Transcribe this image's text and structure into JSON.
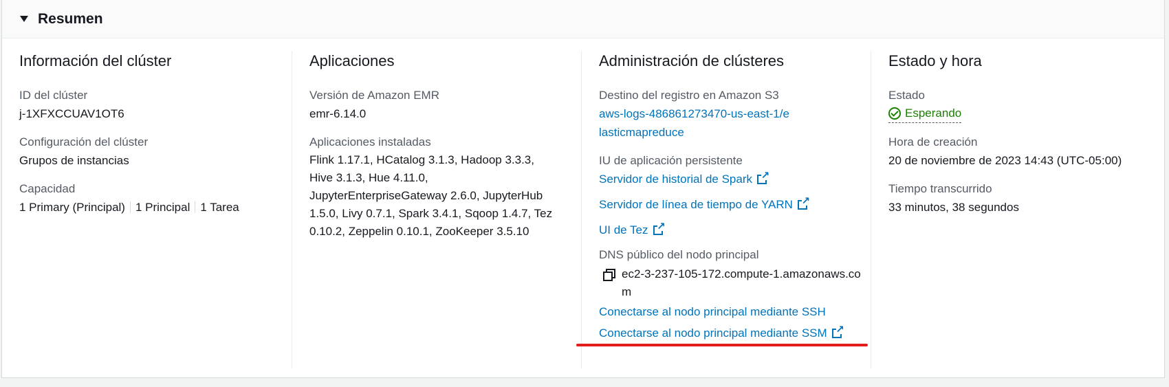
{
  "header": {
    "title": "Resumen"
  },
  "cluster_info": {
    "title": "Información del clúster",
    "id_label": "ID del clúster",
    "id_value": "j-1XFXCCUAV1OT6",
    "config_label": "Configuración del clúster",
    "config_value": "Grupos de instancias",
    "capacity_label": "Capacidad",
    "capacity_items": [
      "1 Primary (Principal)",
      "1 Principal",
      "1 Tarea"
    ]
  },
  "applications": {
    "title": "Aplicaciones",
    "version_label": "Versión de Amazon EMR",
    "version_value": "emr-6.14.0",
    "installed_label": "Aplicaciones instaladas",
    "installed_value": "Flink 1.17.1, HCatalog 3.1.3, Hadoop 3.3.3, Hive 3.1.3, Hue 4.11.0, JupyterEnterpriseGateway 2.6.0, JupyterHub 1.5.0, Livy 0.7.1, Spark 3.4.1, Sqoop 1.4.7, Tez 0.10.2, Zeppelin 0.10.1, ZooKeeper 3.5.10"
  },
  "management": {
    "title": "Administración de clústeres",
    "log_label": "Destino del registro en Amazon S3",
    "log_link": "aws-logs-486861273470-us-east-1/elasticmapreduce",
    "ui_label": "IU de aplicación persistente",
    "ui_links": [
      "Servidor de historial de Spark",
      "Servidor de línea de tiempo de YARN",
      "UI de Tez"
    ],
    "dns_label": "DNS público del nodo principal",
    "dns_value": "ec2-3-237-105-172.compute-1.amazonaws.com",
    "ssh_link": "Conectarse al nodo principal mediante SSH",
    "ssm_link": "Conectarse al nodo principal mediante SSM",
    "icons": {
      "external": "external-link-icon",
      "copy": "copy-icon"
    },
    "annotation_color": "#e31c1c"
  },
  "status_time": {
    "title": "Estado y hora",
    "state_label": "Estado",
    "state_value": "Esperando",
    "state_icon": "check-circle-icon",
    "created_label": "Hora de creación",
    "created_value": "20 de noviembre de 2023 14:43 (UTC-05:00)",
    "elapsed_label": "Tiempo transcurrido",
    "elapsed_value": "33 minutos, 38 segundos"
  },
  "colors": {
    "link": "#0073bb",
    "success": "#1d8102",
    "label": "#545b64",
    "text": "#16191f"
  }
}
